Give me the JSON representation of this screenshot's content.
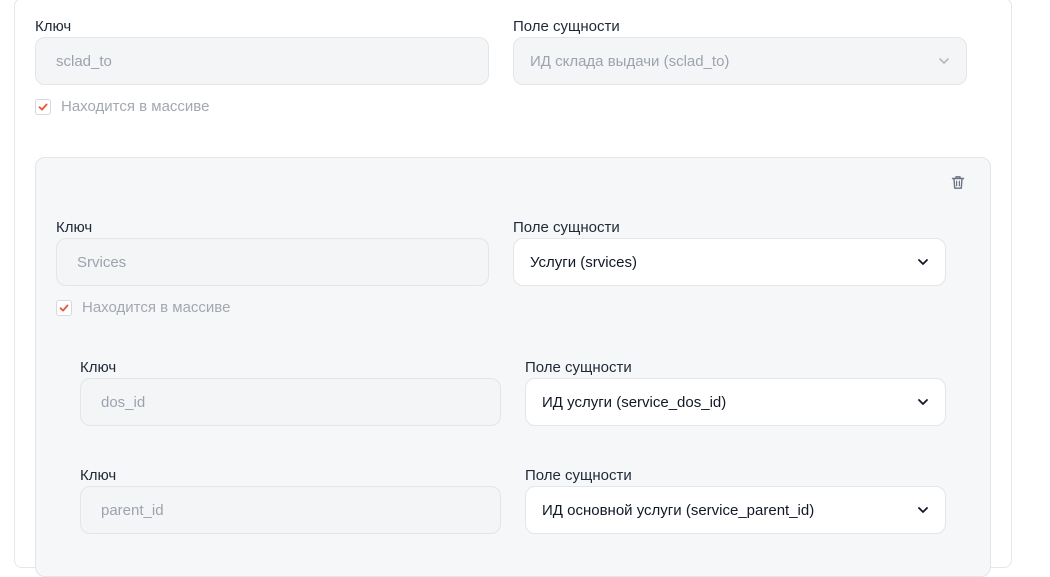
{
  "block1": {
    "key_label": "Ключ",
    "key_value": "sclad_to",
    "field_label": "Поле сущности",
    "field_value": "ИД склада выдачи (sclad_to)",
    "in_array_label": "Находится в массиве",
    "in_array_checked": true
  },
  "block2": {
    "key_label": "Ключ",
    "key_value": "Srvices",
    "field_label": "Поле сущности",
    "field_value": "Услуги (srvices)",
    "in_array_label": "Находится в массиве",
    "in_array_checked": true,
    "children": [
      {
        "key_label": "Ключ",
        "key_value": "dos_id",
        "field_label": "Поле сущности",
        "field_value": "ИД услуги (service_dos_id)"
      },
      {
        "key_label": "Ключ",
        "key_value": "parent_id",
        "field_label": "Поле сущности",
        "field_value": "ИД основной услуги (service_parent_id)"
      }
    ]
  },
  "icons": {
    "delete": "trash-icon",
    "dropdown": "chevron-down-icon",
    "check": "checkmark-icon"
  },
  "colors": {
    "check_accent": "#e8573a",
    "input_bg": "#f4f5f7",
    "card_bg": "#f6f7f8"
  }
}
